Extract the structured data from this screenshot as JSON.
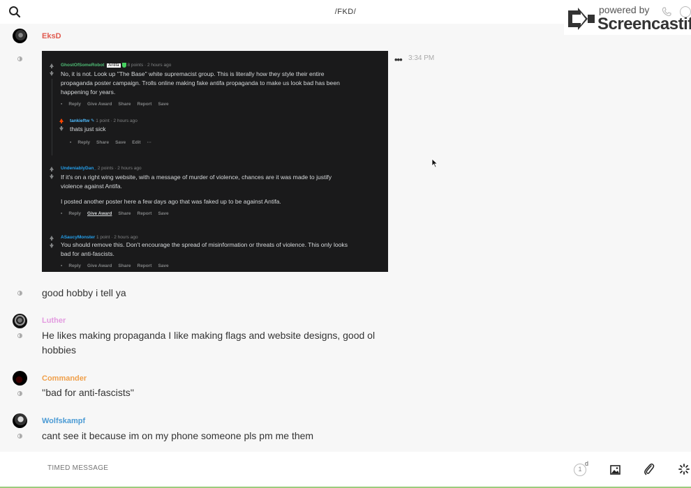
{
  "header": {
    "channel_title": "/FKD/"
  },
  "watermark": {
    "powered_by": "powered by",
    "brand": "Screencastify"
  },
  "messages": [
    {
      "username": "EksD",
      "time": "3:34 PM",
      "embedded_screenshot": {
        "comments": [
          {
            "author": "GhostOfSomeRobot",
            "flair": "Antifa",
            "meta": "8 points · 2 hours ago",
            "lines": [
              "No, it is not. Look up \"The Base\" white supremacist group. This is literally how they style their entire",
              "propaganda poster campaign. Trolls online making fake antifa propaganda to make us look bad has been",
              "happening for years."
            ],
            "actions": [
              "Reply",
              "Give Award",
              "Share",
              "Report",
              "Save"
            ]
          },
          {
            "author": "tankieftw",
            "meta": "1 point · 2 hours ago",
            "lines": [
              "thats just sick"
            ],
            "actions": [
              "Reply",
              "Share",
              "Save",
              "Edit",
              "···"
            ]
          },
          {
            "author": "UndeniablyDan_",
            "meta": "2 points · 2 hours ago",
            "lines": [
              "If it's on a right wing website, with a message of murder of violence, chances are it was made to justify",
              "violence against Antifa.",
              "",
              "I posted another poster here a few days ago that was faked up to be against Antifa."
            ],
            "actions": [
              "Reply",
              "Give Award",
              "Share",
              "Report",
              "Save"
            ]
          },
          {
            "author": "ASaucyMonster",
            "meta": "1 point · 2 hours ago",
            "lines": [
              "You should remove this. Don't encourage the spread of misinformation or threats of violence. This only looks",
              "bad for anti-fascists."
            ],
            "actions": [
              "Reply",
              "Give Award",
              "Share",
              "Report",
              "Save"
            ]
          }
        ]
      },
      "text": "good hobby i tell ya"
    },
    {
      "username": "Luther",
      "text_line1": "He likes making propaganda I like making flags and website designs, good ol",
      "text_line2": "hobbies"
    },
    {
      "username": "Commander",
      "text": "''bad for anti-fascists''"
    },
    {
      "username": "Wolfskampf",
      "text": "cant see it because im on my phone someone pls pm me them"
    }
  ],
  "composer": {
    "placeholder": "TIMED MESSAGE",
    "timer_value": "1",
    "timer_unit": "d"
  },
  "colors": {
    "eksd": "#e05a4f",
    "luther": "#e39be0",
    "commander": "#f0a04b",
    "wolfskampf": "#4a9ad4"
  }
}
